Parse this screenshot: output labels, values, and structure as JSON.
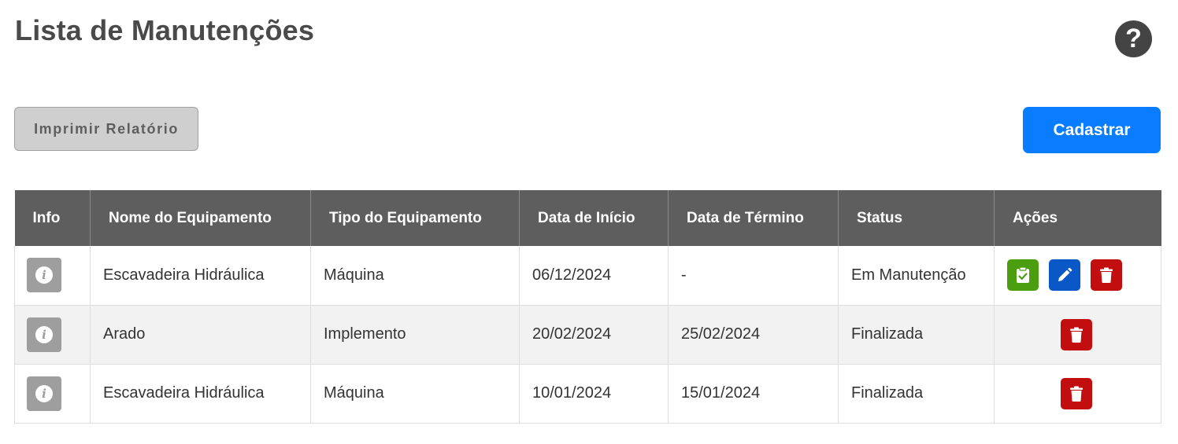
{
  "header": {
    "title": "Lista de Manutenções",
    "help_symbol": "?"
  },
  "toolbar": {
    "print_label": "Imprimir Relatório",
    "register_label": "Cadastrar"
  },
  "table": {
    "columns": [
      "Info",
      "Nome do Equipamento",
      "Tipo do Equipamento",
      "Data de Início",
      "Data de Término",
      "Status",
      "Ações"
    ],
    "rows": [
      {
        "equipment_name": "Escavadeira Hidráulica",
        "equipment_type": "Máquina",
        "start_date": "06/12/2024",
        "end_date": "-",
        "status": "Em Manutenção",
        "actions": [
          "finish",
          "edit",
          "delete"
        ]
      },
      {
        "equipment_name": "Arado",
        "equipment_type": "Implemento",
        "start_date": "20/02/2024",
        "end_date": "25/02/2024",
        "status": "Finalizada",
        "actions": [
          "delete"
        ]
      },
      {
        "equipment_name": "Escavadeira Hidráulica",
        "equipment_type": "Máquina",
        "start_date": "10/01/2024",
        "end_date": "15/01/2024",
        "status": "Finalizada",
        "actions": [
          "delete"
        ]
      }
    ]
  },
  "icons": {
    "help": "question-circle-icon",
    "info": "info-circle-icon",
    "finish": "clipboard-check-icon",
    "edit": "pencil-icon",
    "delete": "trash-icon"
  },
  "colors": {
    "header_bg": "#5e5e5e",
    "primary": "#0a7cff",
    "finish": "#4b9e0f",
    "edit": "#0a57c8",
    "delete": "#c20e0e",
    "info": "#9e9e9e"
  }
}
